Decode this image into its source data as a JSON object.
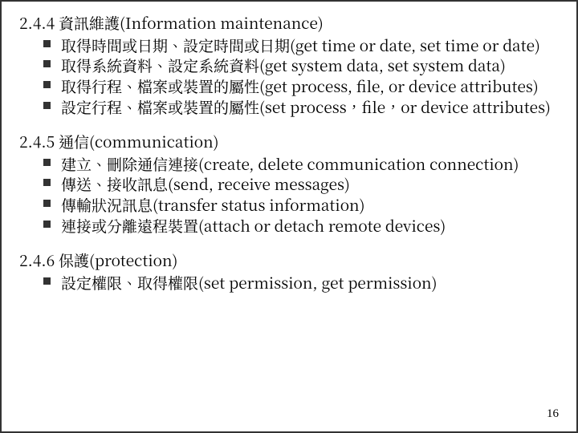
{
  "sections": [
    {
      "heading": "2.4.4 資訊維護(Information maintenance)",
      "items": [
        "取得時間或日期、設定時間或日期(get time or date, set time or date)",
        "取得系統資料、設定系統資料(get system data, set system data)",
        "取得行程、檔案或裝置的屬性(get process, file, or device attributes)",
        "設定行程、檔案或裝置的屬性(set process，file，or device attributes)"
      ]
    },
    {
      "heading": "2.4.5 通信(communication)",
      "items": [
        "建立、刪除通信連接(create, delete communication connection)",
        "傳送、接收訊息(send, receive messages)",
        "傳輸狀況訊息(transfer status information)",
        "連接或分離遠程裝置(attach or detach remote devices)"
      ]
    },
    {
      "heading": "2.4.6 保護(protection)",
      "items": [
        "設定權限、取得權限(set permission, get permission)"
      ]
    }
  ],
  "page_number": "16"
}
